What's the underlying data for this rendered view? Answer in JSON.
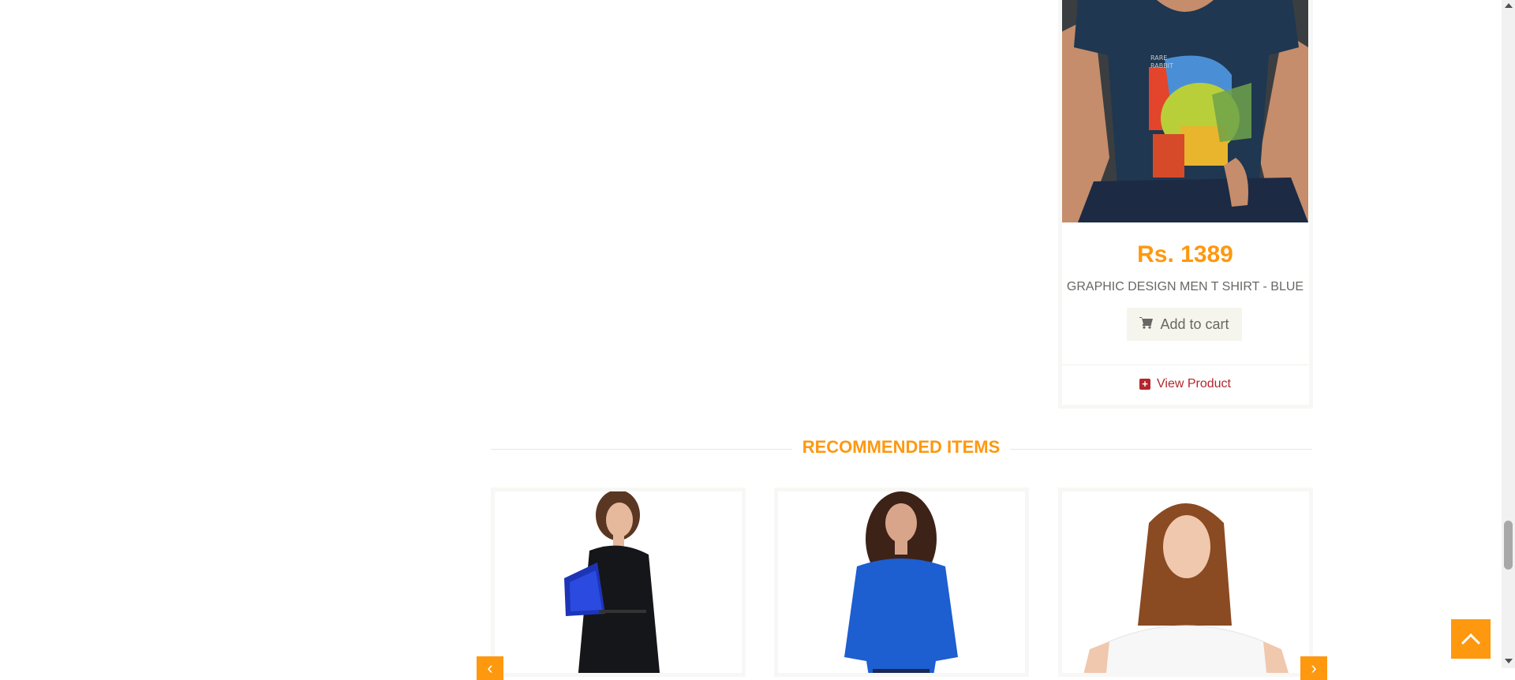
{
  "featured_product": {
    "price": "Rs. 1389",
    "name": "GRAPHIC DESIGN MEN T SHIRT - BLUE",
    "add_to_cart_label": "Add to cart",
    "view_product_label": "View Product",
    "image": "man-blue-graphic-tshirt-photo"
  },
  "recommended": {
    "title": "RECOMMENDED ITEMS",
    "items": [
      {
        "image": "woman-black-dress-blue-bag-photo"
      },
      {
        "image": "woman-blue-sweater-photo"
      },
      {
        "image": "girl-white-tshirt-photo"
      }
    ],
    "prev_icon": "chevron-left-icon",
    "next_icon": "chevron-right-icon"
  },
  "scroll_to_top_icon": "chevron-up-icon",
  "colors": {
    "accent": "#FE980F",
    "text": "#696763",
    "link": "#b3272d",
    "button_bg": "#F5F5ED"
  }
}
